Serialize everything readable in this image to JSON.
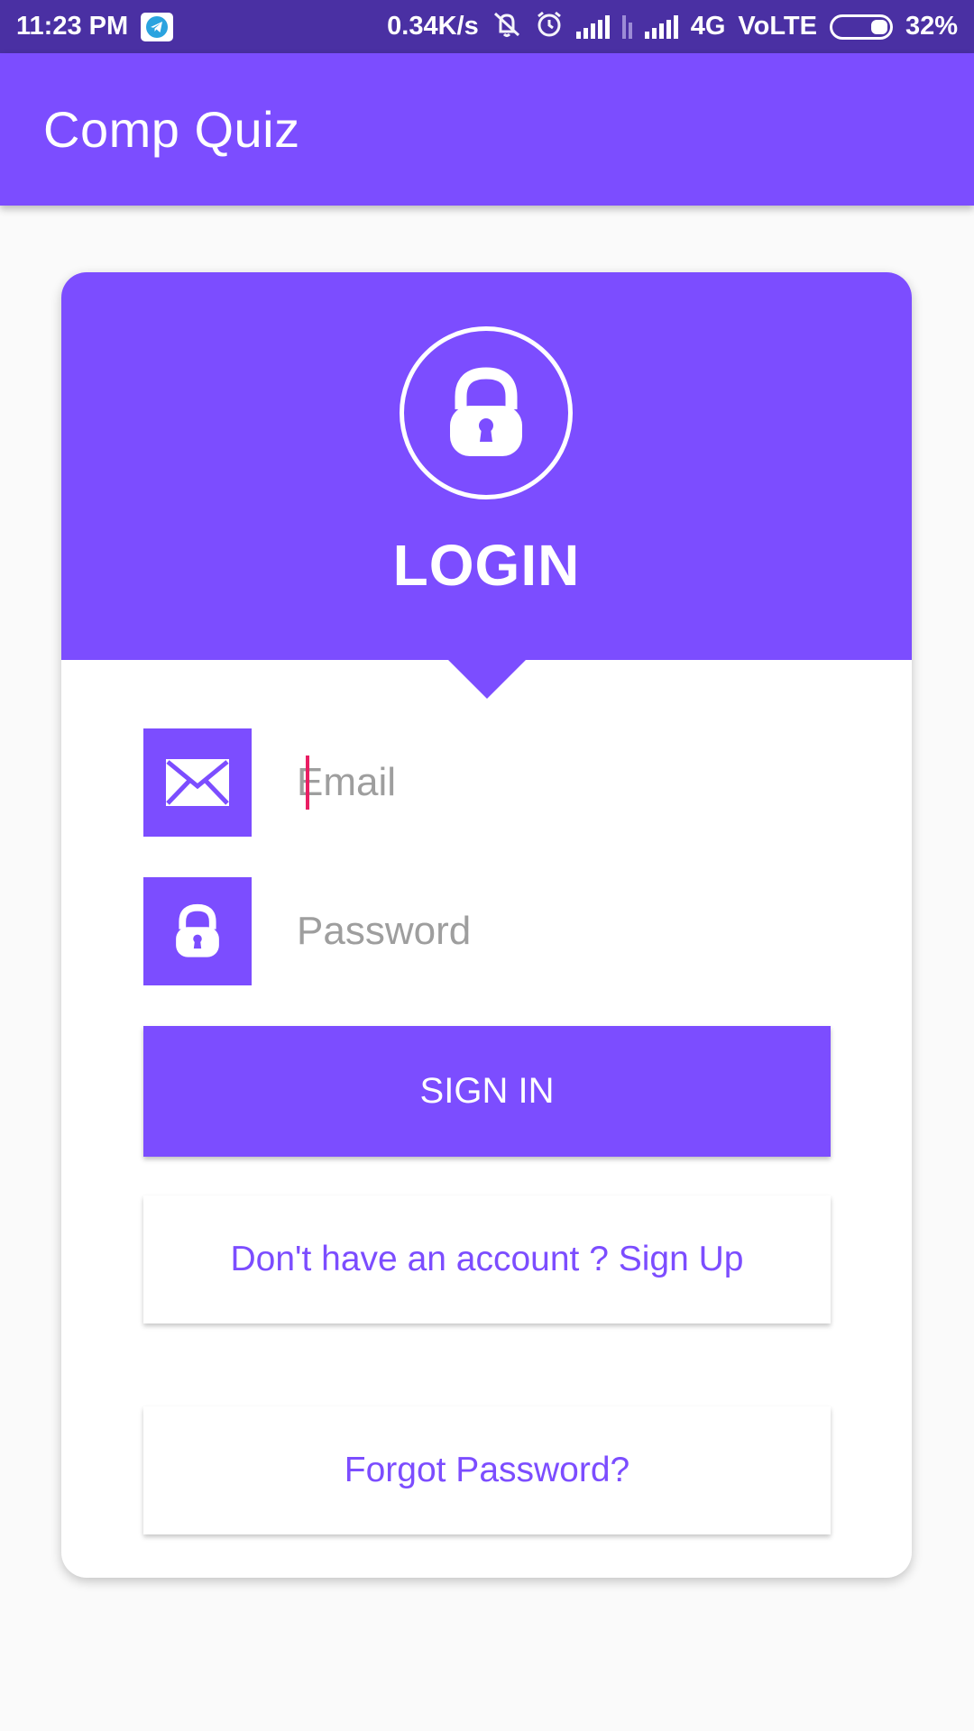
{
  "status_bar": {
    "time": "11:23 PM",
    "network_speed": "0.34K/s",
    "network_type": "4G",
    "volte": "VoLTE",
    "battery": "32%",
    "icons": [
      "telegram-icon",
      "mute-vibrate-icon",
      "alarm-icon",
      "signal-icon",
      "data-arrows-icon",
      "signal-icon",
      "battery-icon"
    ]
  },
  "app_bar": {
    "title": "Comp Quiz"
  },
  "login_card": {
    "header_icon": "lock-icon",
    "title": "LOGIN",
    "email": {
      "icon": "envelope-icon",
      "placeholder": "Email",
      "value": ""
    },
    "password": {
      "icon": "lock-icon",
      "placeholder": "Password",
      "value": ""
    },
    "sign_in_label": "SIGN IN",
    "sign_up_label": "Don't have an account ? Sign Up",
    "forgot_label": "Forgot Password?"
  },
  "colors": {
    "status_bar": "#4a30a3",
    "primary": "#7c4dff",
    "background": "#fafafa",
    "card": "#ffffff",
    "cursor": "#e91e63"
  }
}
